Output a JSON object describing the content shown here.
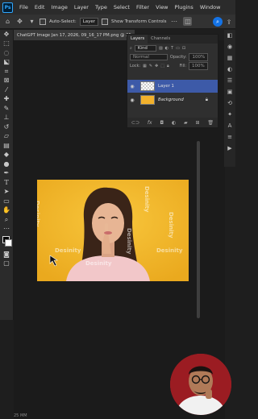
{
  "app": {
    "logo": "Ps"
  },
  "menu": [
    "File",
    "Edit",
    "Image",
    "Layer",
    "Type",
    "Select",
    "Filter",
    "View",
    "Plugins",
    "Window"
  ],
  "options_bar": {
    "auto_select_label": "Auto-Select:",
    "auto_select_value": "Layer",
    "show_transform_label": "Show Transform Controls"
  },
  "document": {
    "tab_title": "ChatGPT Image Jan 17, 2026, 09_16_17 PM.png @ 25"
  },
  "layers_panel": {
    "tabs": [
      "Layers",
      "Channels"
    ],
    "filter_kind": "Kind",
    "blend_mode": "Normal",
    "opacity_label": "Opacity:",
    "opacity_value": "100%",
    "lock_label": "Lock:",
    "fill_label": "Fill:",
    "fill_value": "100%",
    "layers": [
      {
        "name": "Layer 1",
        "selected": true
      },
      {
        "name": "Background",
        "selected": false,
        "locked": true
      }
    ],
    "footer_icons": [
      "link-icon",
      "fx-icon",
      "mask-icon",
      "adjustment-icon",
      "folder-icon",
      "new-layer-icon",
      "trash-icon"
    ]
  },
  "photo": {
    "watermark": "Desinity",
    "background_color": "#f4b82a"
  },
  "statusbar": {
    "zoom": "25 MM"
  },
  "colors": {
    "accent": "#1473e6",
    "selected_layer": "#3d5aa8"
  }
}
